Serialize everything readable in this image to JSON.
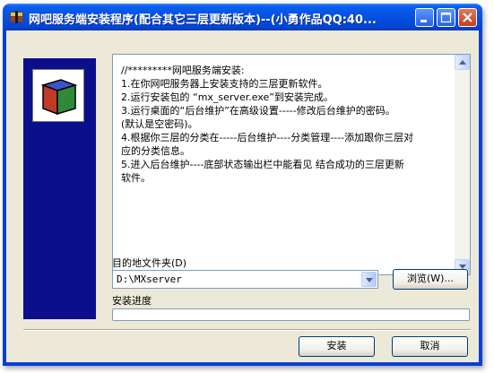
{
  "window": {
    "title": "网吧服务端安装程序(配合其它三层更新版本)--(小勇作品QQ:40..."
  },
  "info": {
    "lines": [
      "//*********网吧服务端安装:",
      "1.在你网吧服务器上安装支持的三层更新软件。",
      "2.运行安装包的 “mx_server.exe”到安装完成。",
      "3.运行桌面的“后台维护”在高级设置-----修改后台维护的密码。",
      "(默认是空密码)。",
      "4.根据你三层的分类在-----后台维护----分类管理----添加跟你三层对",
      "应的分类信息。",
      "5.进入后台维护----底部状态输出栏中能看见 结合成功的三层更新",
      "软件。"
    ]
  },
  "target": {
    "label": "目的地文件夹(D)",
    "value": "D:\\MXserver",
    "browse_label": "浏览(W)..."
  },
  "progress": {
    "label": "安装进度",
    "value": 0
  },
  "actions": {
    "install_label": "安装",
    "cancel_label": "取消"
  },
  "colors": {
    "titlebar": "#0552e1",
    "sidebar": "#0c0f8c",
    "dialog": "#ece9d8"
  }
}
